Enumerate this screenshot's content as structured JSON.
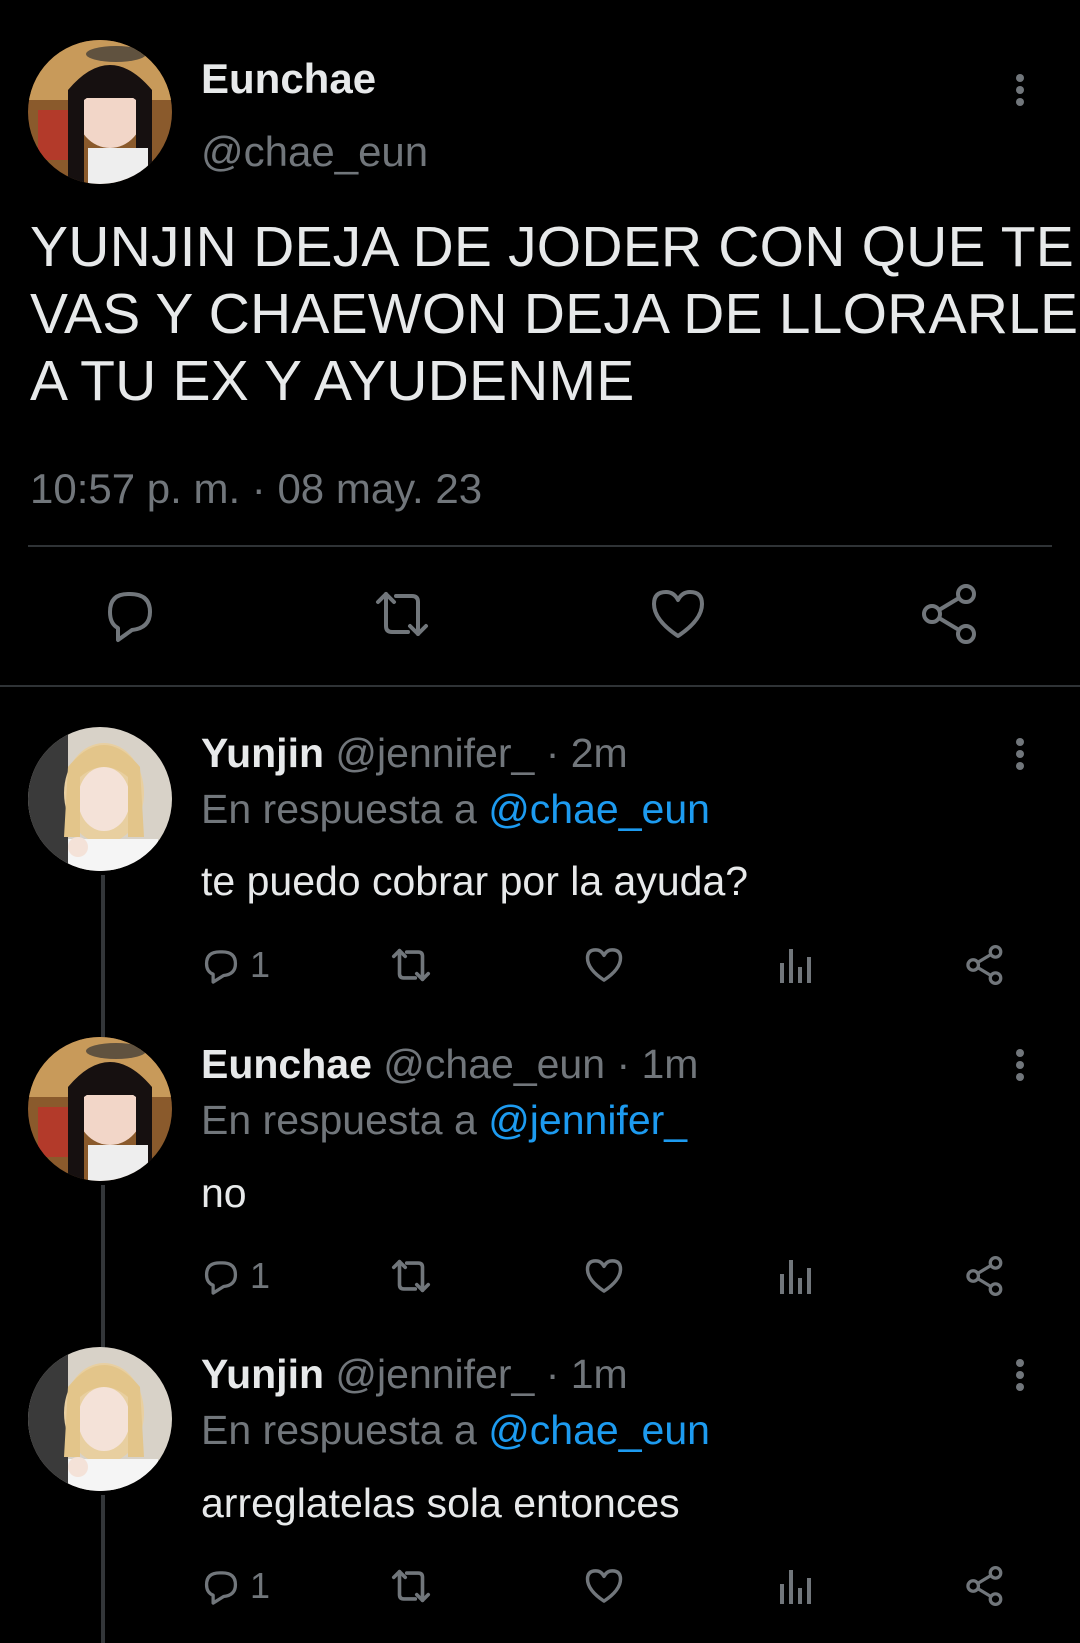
{
  "main_tweet": {
    "author_name": "Eunchae",
    "author_handle": "@chae_eun",
    "text_lines": [
      "YUNJIN DEJA DE JODER CON QUE TE",
      "VAS Y CHAEWON DEJA DE LLORARLE",
      "A TU EX Y AYUDENME"
    ],
    "timestamp": "10:57 p. m. · 08 may. 23"
  },
  "replies": [
    {
      "author_name": "Yunjin",
      "author_handle": "@jennifer_",
      "time": " · 2m",
      "reply_prefix": "En respuesta a ",
      "reply_to": "@chae_eun",
      "text": "te puedo cobrar por la ayuda?",
      "reply_count": "1"
    },
    {
      "author_name": "Eunchae",
      "author_handle": "@chae_eun",
      "time": " · 1m",
      "reply_prefix": "En respuesta a ",
      "reply_to": "@jennifer_",
      "text": "no",
      "reply_count": "1"
    },
    {
      "author_name": "Yunjin",
      "author_handle": "@jennifer_",
      "time": " · 1m",
      "reply_prefix": "En respuesta a ",
      "reply_to": "@chae_eun",
      "text": "arreglatelas sola entonces",
      "reply_count": "1"
    }
  ],
  "icons": {
    "reply": "reply-bubble-icon",
    "retweet": "retweet-icon",
    "like": "heart-icon",
    "views": "views-bar-chart-icon",
    "share": "share-icon",
    "more": "more-options-icon"
  },
  "colors": {
    "background": "#000000",
    "text": "#e7e9ea",
    "muted": "#71767b",
    "link": "#1d9bf0",
    "divider": "#2f3336"
  }
}
